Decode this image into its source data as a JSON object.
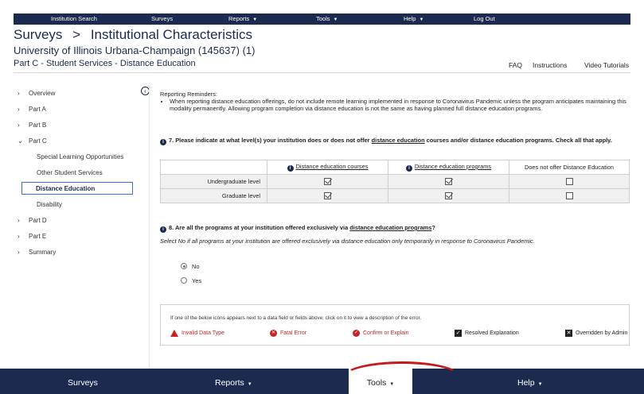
{
  "topnav": {
    "items": [
      "Institution Search",
      "Surveys",
      "Reports",
      "Tools",
      "Help",
      "Log Out"
    ]
  },
  "breadcrumb": {
    "root": "Surveys",
    "sep": ">",
    "current": "Institutional Characteristics"
  },
  "institution": "University of Illinois Urbana-Champaign (145637) (1)",
  "part_title": "Part C - Student Services - Distance Education",
  "toplinks": [
    "FAQ",
    "Instructions",
    "Video Tutorials"
  ],
  "sidebar": {
    "items": [
      "Overview",
      "Part A",
      "Part B",
      "Part C",
      "Part D",
      "Part E",
      "Summary"
    ],
    "partc_subs": [
      "Special Learning Opportunities",
      "Other Student Services",
      "Distance Education",
      "Disability"
    ]
  },
  "reminders": {
    "title": "Reporting Reminders:",
    "bullet": "When reporting distance education offerings, do not include remote learning implemented in response to Coronavirus Pandemic unless the program anticipates maintaining this modality permanently. Allowing program completion via distance education is not the same as having planned full distance education programs."
  },
  "q7": {
    "prefix": "7. Please indicate at what level(s) your institution does or does not offer",
    "link": "distance education",
    "suffix": "courses and/or distance education programs. Check all that apply.",
    "columns": [
      "Distance education courses",
      "Distance education programs",
      "Does not offer Distance Education"
    ],
    "rows": [
      {
        "label": "Undergraduate level",
        "values": [
          true,
          true,
          false
        ]
      },
      {
        "label": "Graduate level",
        "values": [
          true,
          true,
          false
        ]
      }
    ]
  },
  "q8": {
    "prefix": "8. Are all the programs at your institution offered exclusively via",
    "link": "distance education programs",
    "suffix": "?",
    "note": "Select No if all programs at your institution are offered exclusively via distance education only temporarily in response to Coronavirus Pandemic.",
    "options": [
      "No",
      "Yes"
    ],
    "selected": "No"
  },
  "legend": {
    "note": "If one of the below icons appears next to a data field or fields above, click on it to view a description of the error.",
    "items": [
      "Invalid Data Type",
      "Fatal Error",
      "Confirm or Explain",
      "Resolved Explanation",
      "Overridden by Admin"
    ]
  },
  "bottombar": {
    "items": [
      "Surveys",
      "Reports",
      "Tools",
      "Help"
    ]
  },
  "colors": {
    "navy": "#1b2a4e",
    "error_red": "#c82222"
  }
}
